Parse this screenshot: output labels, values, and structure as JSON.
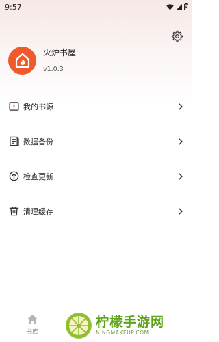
{
  "status_bar": {
    "time": "9:57",
    "icons": [
      "wifi-icon",
      "signal-icon",
      "battery-icon"
    ]
  },
  "header": {
    "settings_icon": "gear-icon"
  },
  "profile": {
    "app_name": "火炉书屋",
    "version": "v1.0.3",
    "avatar_color": "#ee5a2a"
  },
  "menu": {
    "items": [
      {
        "label": "我的书源",
        "icon": "book-source-icon"
      },
      {
        "label": "数据备份",
        "icon": "backup-icon"
      },
      {
        "label": "检查更新",
        "icon": "update-icon"
      },
      {
        "label": "清理缓存",
        "icon": "trash-icon"
      }
    ]
  },
  "bottom_nav": {
    "tabs": [
      {
        "label": "书库",
        "icon": "home-icon"
      }
    ]
  },
  "watermark": {
    "title": "柠檬手游网",
    "subtitle": "NINGMAKEUP.COM",
    "color": "#5fa31c"
  }
}
